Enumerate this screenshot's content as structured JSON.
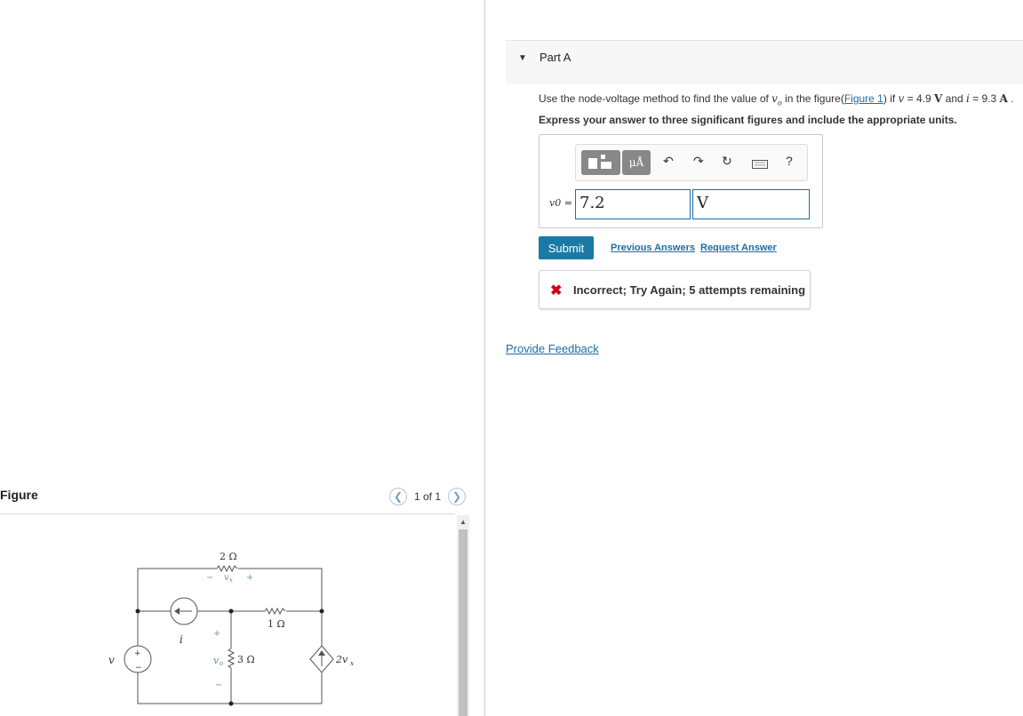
{
  "figure": {
    "title": "Figure",
    "pager": {
      "text": "1 of 1"
    },
    "circuit": {
      "r1": "2 Ω",
      "r2": "1 Ω",
      "r3": "3 Ω",
      "vx": "v",
      "vx_sub": "x",
      "vo": "v",
      "vo_sub": "o",
      "i": "i",
      "v": "v",
      "dep": "2v",
      "dep_sub": "x",
      "plus": "+",
      "minus": "−"
    }
  },
  "part": {
    "title": "Part A",
    "question_pre": "Use the node-voltage method to find the value of ",
    "question_vo": "v",
    "question_vo_sub": "o",
    "question_mid": " in the figure",
    "figure_link": "Figure 1",
    "question_if": " if ",
    "q_v": "v",
    "q_v_val": " = 4.9 ",
    "q_v_unit": "V",
    "q_and": " and ",
    "q_i": "i",
    "q_i_val": " = 9.3 ",
    "q_i_unit": "A",
    "q_end": " .",
    "instruction": "Express your answer to three significant figures and include the appropriate units."
  },
  "answer": {
    "label": "v0 =",
    "value": "7.2",
    "unit": "V",
    "toolbar": {
      "units_label": "μÅ",
      "help": "?"
    }
  },
  "actions": {
    "submit": "Submit",
    "previous_answers": "Previous Answers",
    "request_answer": "Request Answer"
  },
  "feedback": {
    "message": "Incorrect; Try Again; 5 attempts remaining"
  },
  "provide_feedback": "Provide Feedback",
  "colors": {
    "accent": "#1a7aa5",
    "error": "#d0021b",
    "link": "#1a6ea8"
  }
}
